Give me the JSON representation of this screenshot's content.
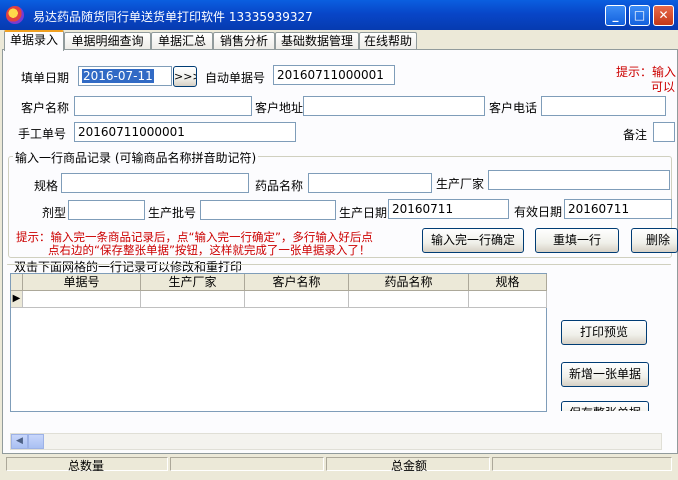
{
  "window": {
    "title": "易达药品随货同行单送货单打印软件  13335939327",
    "minimize_glyph": "_",
    "maximize_glyph": "□",
    "close_glyph": "✕"
  },
  "tabs": [
    "单据录入",
    "单据明细查询",
    "单据汇总",
    "销售分析",
    "基础数据管理",
    "在线帮助"
  ],
  "header_form": {
    "fill_date_label": "填单日期",
    "fill_date_value": "2016-07-11",
    "date_picker_label": ">>>",
    "auto_no_label": "自动单据号",
    "auto_no_value": "20160711000001",
    "hint_right_line1": "提示：输入",
    "hint_right_line2": "可以",
    "customer_name_label": "客户名称",
    "customer_name_value": "",
    "customer_address_label": "客户地址",
    "customer_address_value": "",
    "customer_phone_label": "客户电话",
    "customer_phone_value": "",
    "manual_no_label": "手工单号",
    "manual_no_value": "20160711000001",
    "remark_label": "备注",
    "remark_value": ""
  },
  "item_group": {
    "title": "输入一行商品记录 (可输商品名称拼音助记符)",
    "spec_label": "规格",
    "spec_value": "",
    "drug_name_label": "药品名称",
    "drug_name_value": "",
    "manufacturer_label": "生产厂家",
    "manufacturer_value": "",
    "dosage_label": "剂型",
    "dosage_value": "",
    "batch_label": "生产批号",
    "batch_value": "",
    "production_date_label": "生产日期",
    "production_date_value": "20160711",
    "expiry_label": "有效日期",
    "expiry_value": "20160711",
    "hint_line1": "提示：输入完一条商品记录后，点“输入完一行确定”，多行输入好后点",
    "hint_line2": "点右边的“保存整张单据”按钮，这样就完成了一张单据录入了！",
    "confirm_row_label": "输入完一行确定",
    "refill_row_label": "重填一行",
    "delete_label": "删除"
  },
  "grid_section": {
    "title": "双击下面网格的一行记录可以修改和重打印",
    "columns": [
      "单据号",
      "生产厂家",
      "客户名称",
      "药品名称",
      "规格"
    ],
    "row_indicator": "▶"
  },
  "side_buttons": {
    "print_preview": "打印预览",
    "new_document": "新增一张单据",
    "save_document": "保存整张单据"
  },
  "scrollbar": {
    "left_arrow": "◀"
  },
  "status": {
    "total_qty_label": "总数量",
    "total_amount_label": "总金额"
  }
}
